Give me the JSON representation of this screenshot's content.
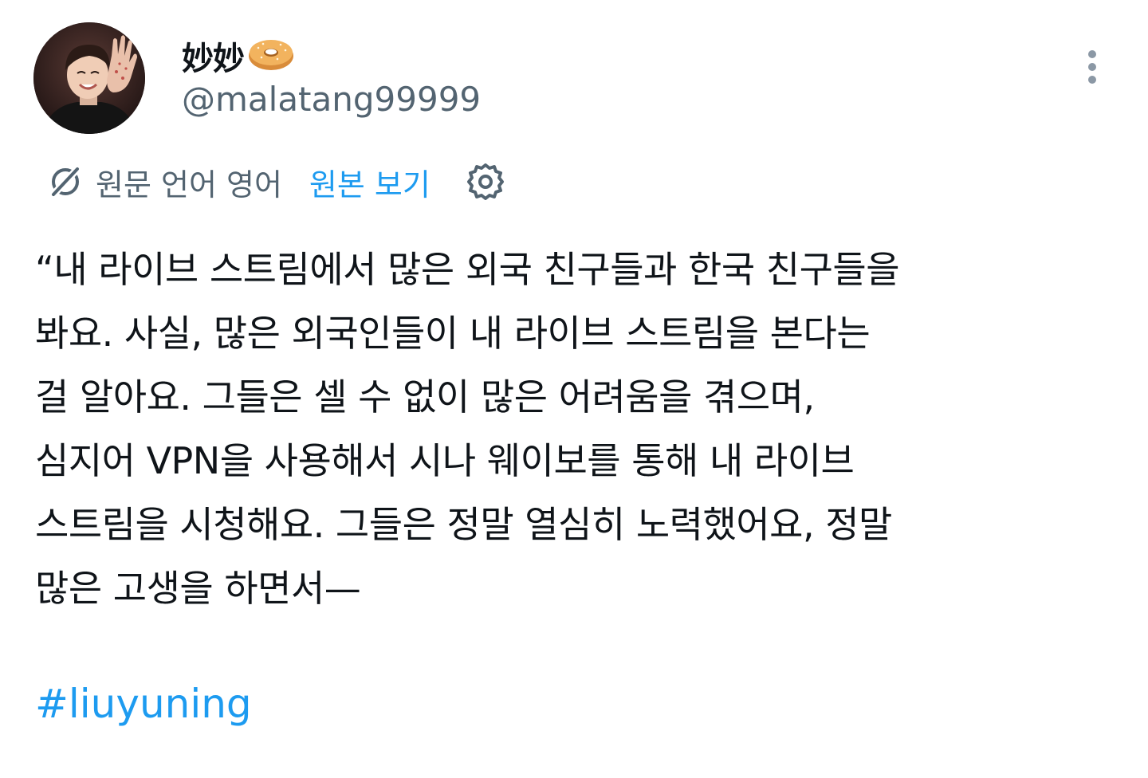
{
  "author": {
    "display_name": "妙妙",
    "name_emoji": "bagel-icon",
    "handle": "@malatang99999",
    "avatar": "profile-photo-waving-person"
  },
  "translation": {
    "icon": "translate-slash-icon",
    "label": "원문 언어 영어",
    "show_original": "원본 보기",
    "settings_icon": "gear-icon"
  },
  "menu": {
    "icon": "more-vertical-icon"
  },
  "tweet": {
    "lines": [
      "“내 라이브 스트림에서 많은 외국 친구들과 한국 친구들을",
      "봐요. 사실, 많은 외국인들이 내 라이브 스트림을 본다는",
      "걸 알아요. 그들은 셀 수 없이 많은 어려움을 겪으며,",
      "심지어 VPN을 사용해서 시나 웨이보를 통해 내 라이브",
      "스트림을 시청해요. 그들은 정말 열심히 노력했어요, 정말",
      "많은 고생을 하면서—"
    ],
    "hashtag": "#liuyuning"
  },
  "colors": {
    "text_primary": "#0f1419",
    "text_secondary": "#536471",
    "link": "#1d9bf0",
    "background": "#ffffff"
  }
}
